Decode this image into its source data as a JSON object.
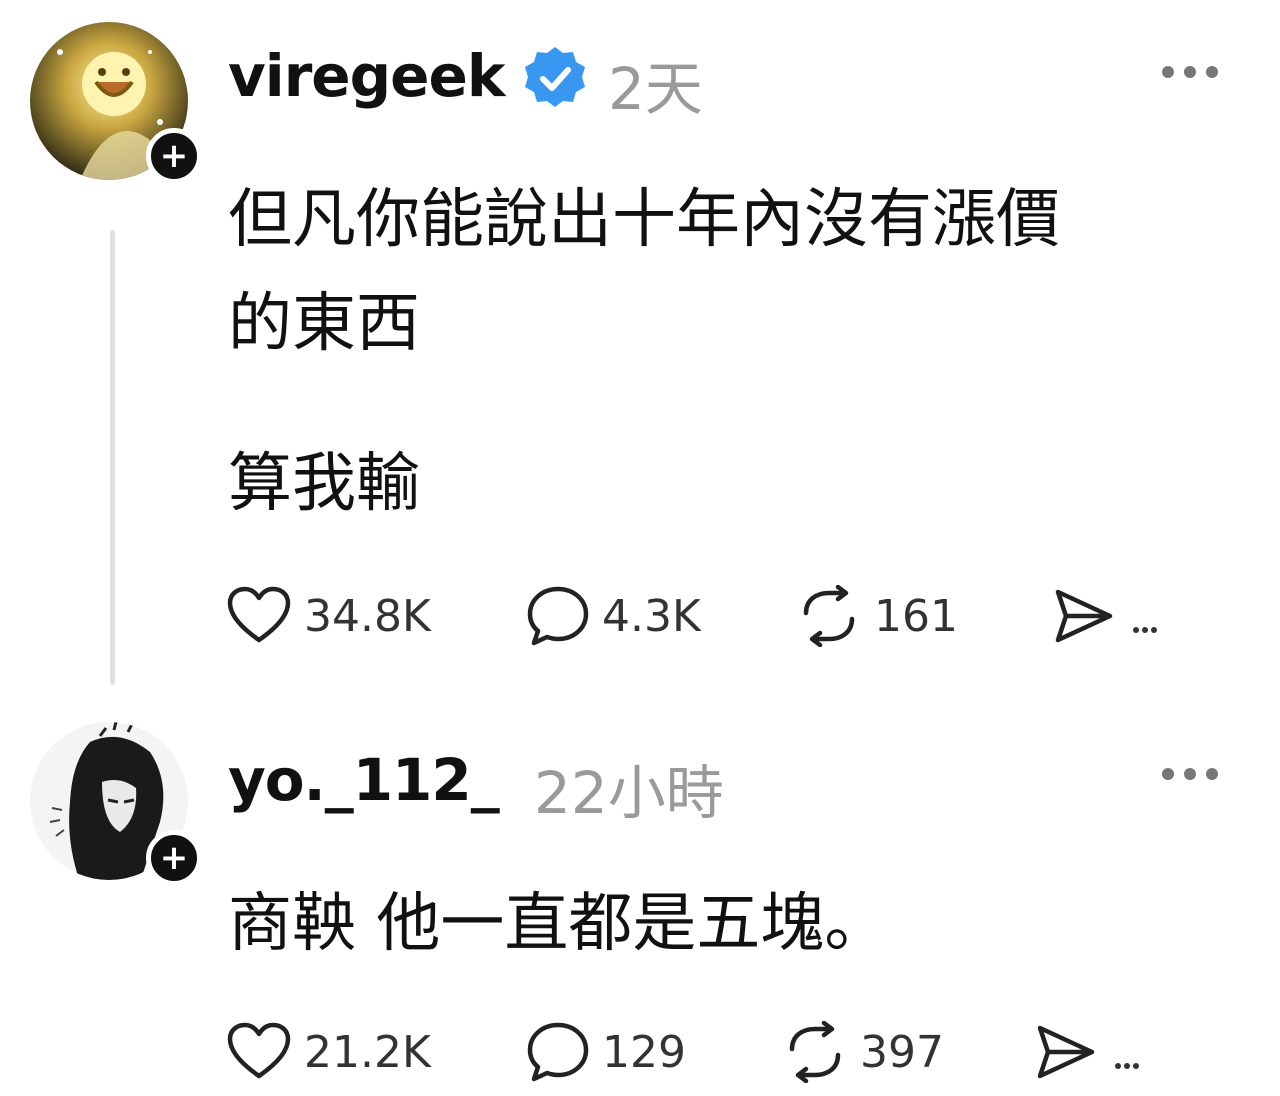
{
  "posts": [
    {
      "username": "viregeek",
      "verified": true,
      "time": "2天",
      "lines": [
        "但凡你能說出十年內沒有漲價",
        "的東西",
        "算我輸"
      ],
      "likes": "34.8K",
      "replies": "4.3K",
      "reposts": "161"
    },
    {
      "username": "yo._112_",
      "verified": false,
      "time": "22小時",
      "lines": [
        "商鞅 他一直都是五塊。"
      ],
      "likes": "21.2K",
      "replies": "129",
      "reposts": "397"
    }
  ],
  "icons": {
    "like": "heart-icon",
    "reply": "comment-icon",
    "repost": "repost-icon",
    "share": "send-icon",
    "more": "more-options-icon",
    "follow": "plus-icon",
    "verified": "verified-badge-icon"
  },
  "colors": {
    "verified_badge": "#3897f0",
    "timestamp": "#9a9a9a",
    "thread_line": "#e1e1e1"
  }
}
